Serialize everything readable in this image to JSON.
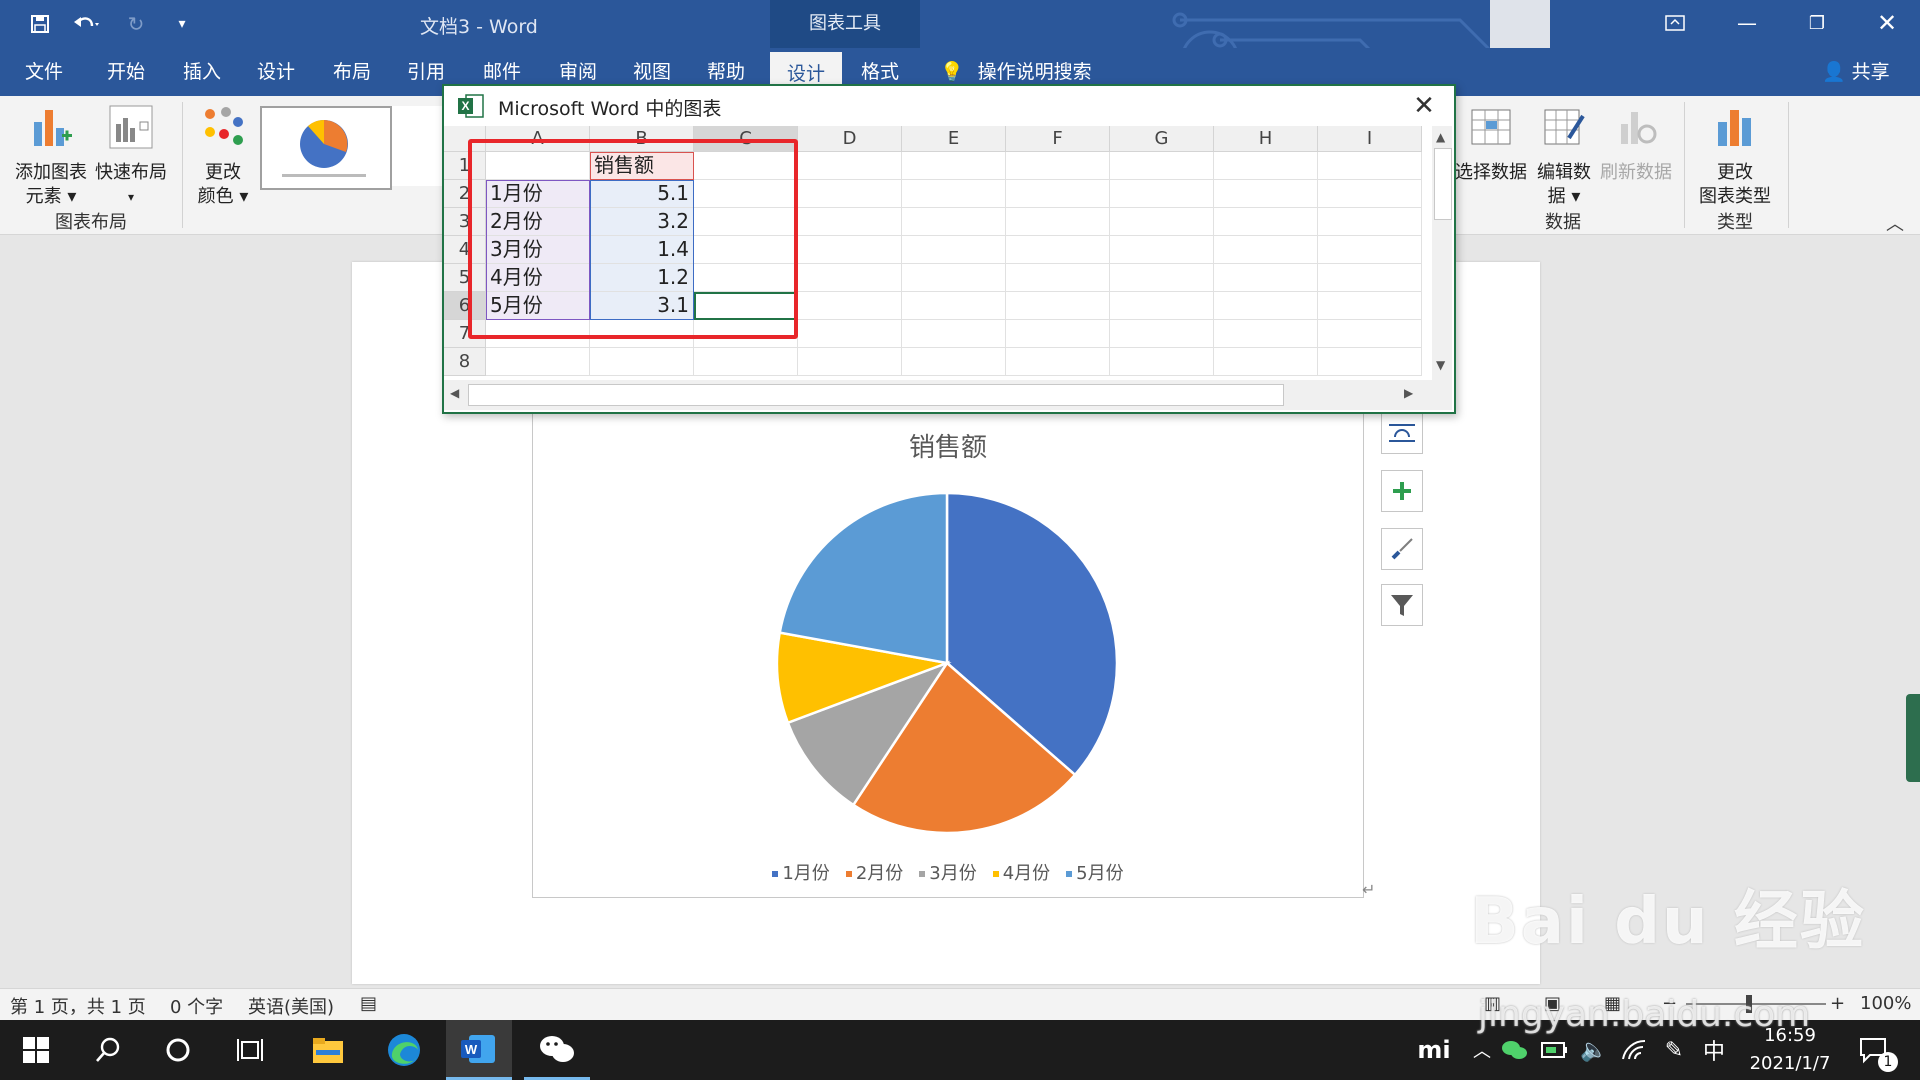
{
  "titlebar": {
    "doc_title": "文档3  -  Word",
    "chart_tools": "图表工具"
  },
  "menu": {
    "tabs": [
      "文件",
      "开始",
      "插入",
      "设计",
      "布局",
      "引用",
      "邮件",
      "审阅",
      "视图",
      "帮助",
      "设计",
      "格式"
    ],
    "active_index": 10,
    "tell_me": "操作说明搜索",
    "share": "共享"
  },
  "ribbon": {
    "add_element": [
      "添加图表",
      "元素 ▾"
    ],
    "quick_layout": [
      "快速布局",
      "▾"
    ],
    "change_colors": [
      "更改",
      "颜色 ▾"
    ],
    "group_layout": "图表布局",
    "select_data": "选择数据",
    "edit_data": [
      "编辑数",
      "据 ▾"
    ],
    "refresh_data": "刷新数据",
    "group_data": "数据",
    "change_type": [
      "更改",
      "图表类型"
    ],
    "group_type": "类型"
  },
  "popup": {
    "title": "Microsoft Word 中的图表",
    "columns": [
      "A",
      "B",
      "C",
      "D",
      "E",
      "F",
      "G",
      "H",
      "I"
    ],
    "rows": [
      "1",
      "2",
      "3",
      "4",
      "5",
      "6",
      "7",
      "8"
    ],
    "header_b": "销售额",
    "data": [
      {
        "label": "1月份",
        "value": "5.1"
      },
      {
        "label": "2月份",
        "value": "3.2"
      },
      {
        "label": "3月份",
        "value": "1.4"
      },
      {
        "label": "4月份",
        "value": "1.2"
      },
      {
        "label": "5月份",
        "value": "3.1"
      }
    ]
  },
  "chart_data": {
    "type": "pie",
    "title": "销售额",
    "categories": [
      "1月份",
      "2月份",
      "3月份",
      "4月份",
      "5月份"
    ],
    "values": [
      5.1,
      3.2,
      1.4,
      1.2,
      3.1
    ],
    "colors": [
      "#4472c4",
      "#ed7d31",
      "#a5a5a5",
      "#ffc000",
      "#5b9bd5"
    ],
    "legend": "bottom"
  },
  "statusbar": {
    "page": "第 1 页，共 1 页",
    "words": "0 个字",
    "lang": "英语(美国)",
    "zoom": "100%"
  },
  "taskbar": {
    "ime": "中",
    "time": "16:59",
    "date": "2021/1/7",
    "notif_count": "1"
  },
  "watermark": {
    "brand": "Bai du 经验",
    "url": "jingyan.baidu.com"
  }
}
